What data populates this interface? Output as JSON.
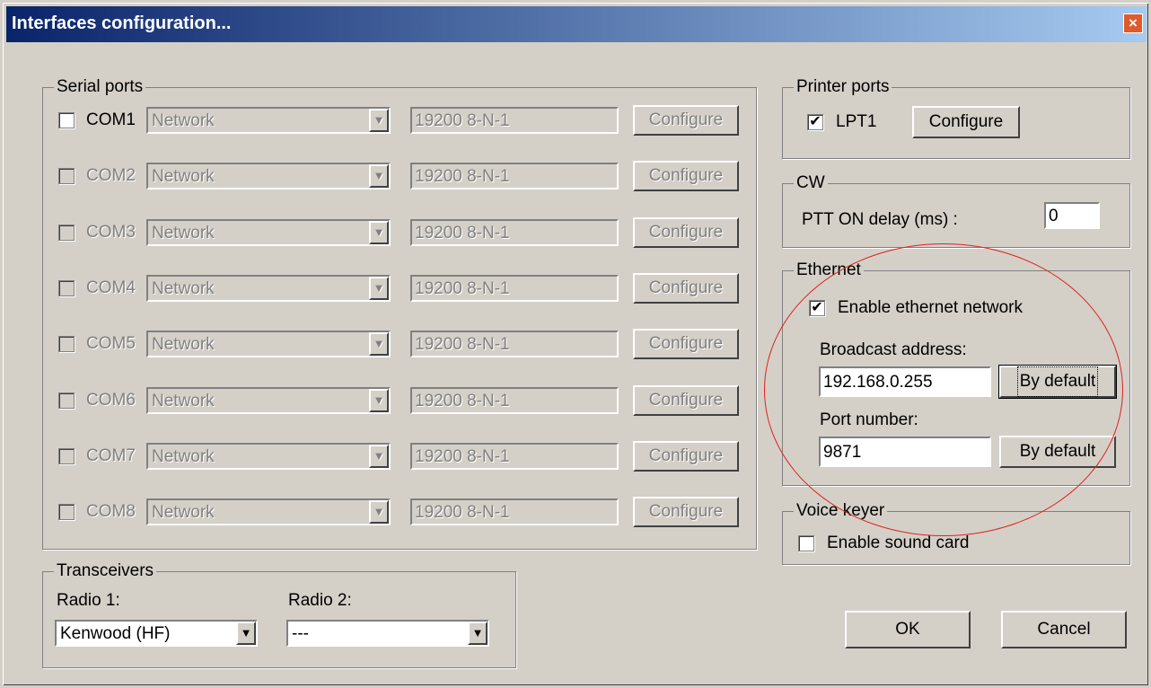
{
  "window": {
    "title": "Interfaces configuration...",
    "close_symbol": "×"
  },
  "serial": {
    "legend": "Serial ports",
    "ports": [
      {
        "name": "COM1",
        "checked": false,
        "enabled": true,
        "mode": "Network",
        "settings": "19200 8-N-1",
        "button": "Configure"
      },
      {
        "name": "COM2",
        "checked": false,
        "enabled": false,
        "mode": "Network",
        "settings": "19200 8-N-1",
        "button": "Configure"
      },
      {
        "name": "COM3",
        "checked": false,
        "enabled": false,
        "mode": "Network",
        "settings": "19200 8-N-1",
        "button": "Configure"
      },
      {
        "name": "COM4",
        "checked": false,
        "enabled": false,
        "mode": "Network",
        "settings": "19200 8-N-1",
        "button": "Configure"
      },
      {
        "name": "COM5",
        "checked": false,
        "enabled": false,
        "mode": "Network",
        "settings": "19200 8-N-1",
        "button": "Configure"
      },
      {
        "name": "COM6",
        "checked": false,
        "enabled": false,
        "mode": "Network",
        "settings": "19200 8-N-1",
        "button": "Configure"
      },
      {
        "name": "COM7",
        "checked": false,
        "enabled": false,
        "mode": "Network",
        "settings": "19200 8-N-1",
        "button": "Configure"
      },
      {
        "name": "COM8",
        "checked": false,
        "enabled": false,
        "mode": "Network",
        "settings": "19200 8-N-1",
        "button": "Configure"
      }
    ]
  },
  "transceivers": {
    "legend": "Transceivers",
    "radio1_label": "Radio 1:",
    "radio1_value": "Kenwood (HF)",
    "radio2_label": "Radio 2:",
    "radio2_value": "---"
  },
  "printer": {
    "legend": "Printer ports",
    "port": "LPT1",
    "checked": true,
    "button": "Configure"
  },
  "cw": {
    "legend": "CW",
    "ptt_label": "PTT ON delay (ms) :",
    "ptt_value": "0"
  },
  "ethernet": {
    "legend": "Ethernet",
    "enable_label": "Enable ethernet network",
    "enabled": true,
    "broadcast_label": "Broadcast address:",
    "broadcast_value": "192.168.0.255",
    "broadcast_default": "By default",
    "port_label": "Port number:",
    "port_value": "9871",
    "port_default": "By default"
  },
  "voice": {
    "legend": "Voice keyer",
    "enable_label": "Enable sound card",
    "enabled": false
  },
  "buttons": {
    "ok": "OK",
    "cancel": "Cancel"
  },
  "icons": {
    "checkmark": "✔",
    "dropdown_arrow": "▼"
  },
  "colors": {
    "annotation_circle": "#e02020",
    "title_bar": "#0a246a"
  }
}
